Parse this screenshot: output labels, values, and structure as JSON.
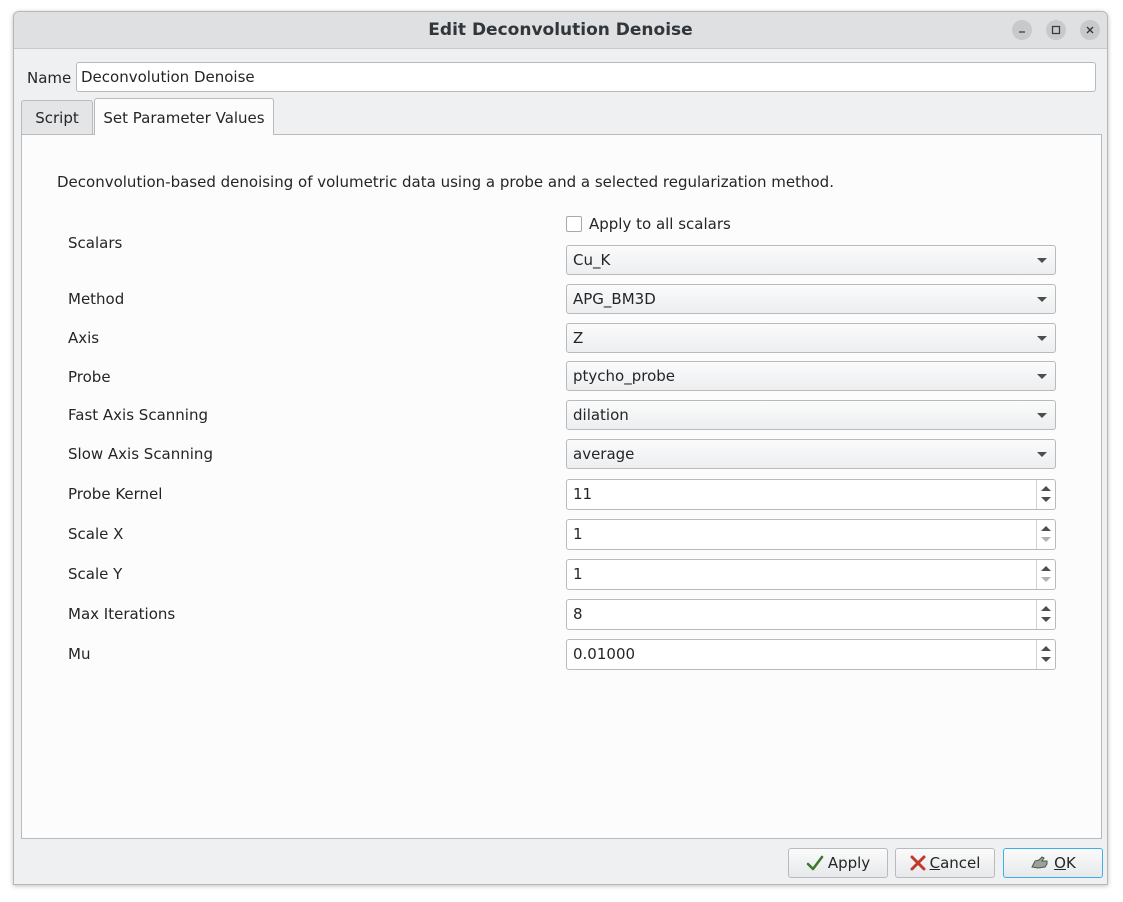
{
  "window": {
    "title": "Edit Deconvolution Denoise",
    "controls": [
      "minimize-icon",
      "maximize-icon",
      "close-icon"
    ]
  },
  "name_field": {
    "label": "Name",
    "value": "Deconvolution Denoise"
  },
  "tabs": [
    {
      "label": "Script",
      "selected": false
    },
    {
      "label": "Set Parameter Values",
      "selected": true
    }
  ],
  "description": "Deconvolution-based denoising of volumetric data using a probe and a selected regularization method.",
  "params": {
    "scalars": {
      "label": "Scalars",
      "checkbox_label": "Apply to all scalars",
      "checked": false,
      "value": "Cu_K"
    },
    "method": {
      "label": "Method",
      "value": "APG_BM3D"
    },
    "axis": {
      "label": "Axis",
      "value": "Z"
    },
    "probe": {
      "label": "Probe",
      "value": "ptycho_probe"
    },
    "fast_axis": {
      "label": "Fast Axis Scanning",
      "value": "dilation"
    },
    "slow_axis": {
      "label": "Slow Axis Scanning",
      "value": "average"
    },
    "probe_kernel": {
      "label": "Probe Kernel",
      "value": "11"
    },
    "scale_x": {
      "label": "Scale X",
      "value": "1"
    },
    "scale_y": {
      "label": "Scale Y",
      "value": "1"
    },
    "max_iterations": {
      "label": "Max Iterations",
      "value": "8"
    },
    "mu": {
      "label": "Mu",
      "value": "0.01000"
    }
  },
  "buttons": {
    "apply": {
      "label": "Apply",
      "icon": "checkmark-icon"
    },
    "cancel": {
      "label_mnemonic": "C",
      "label_rest": "ancel",
      "icon": "x-icon"
    },
    "ok": {
      "label_mnemonic": "O",
      "label_rest": "K",
      "icon": "ok-hand-icon"
    }
  },
  "colors": {
    "focus_accent": "#3daee9",
    "apply_check": "#3c7a2e",
    "cancel_x": "#c0392b"
  }
}
